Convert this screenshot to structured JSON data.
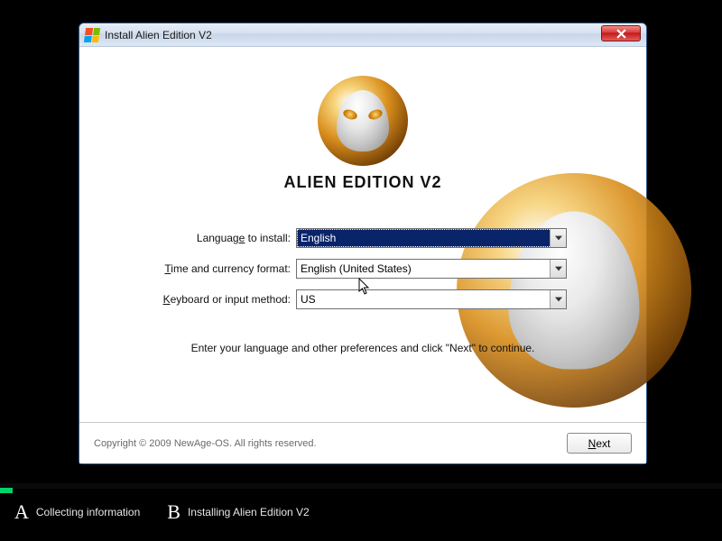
{
  "window": {
    "title": "Install Alien Edition V2"
  },
  "hero": {
    "title": "ALIEN EDITION V2"
  },
  "form": {
    "language_label_pre": "Languag",
    "language_label_ul": "e",
    "language_label_post": " to install:",
    "language_value": "English",
    "currency_label_ul": "T",
    "currency_label_post": "ime and currency format:",
    "currency_value": "English (United States)",
    "keyboard_label_ul": "K",
    "keyboard_label_post": "eyboard or input method:",
    "keyboard_value": "US",
    "instruction": "Enter your language and other preferences and click \"Next\" to continue."
  },
  "footer": {
    "copyright": "Copyright © 2009 NewAge-OS. All rights reserved.",
    "next_ul": "N",
    "next_post": "ext"
  },
  "steps": {
    "a_marker": "A",
    "a_label": "Collecting information",
    "b_marker": "B",
    "b_label": "Installing Alien Edition V2"
  }
}
